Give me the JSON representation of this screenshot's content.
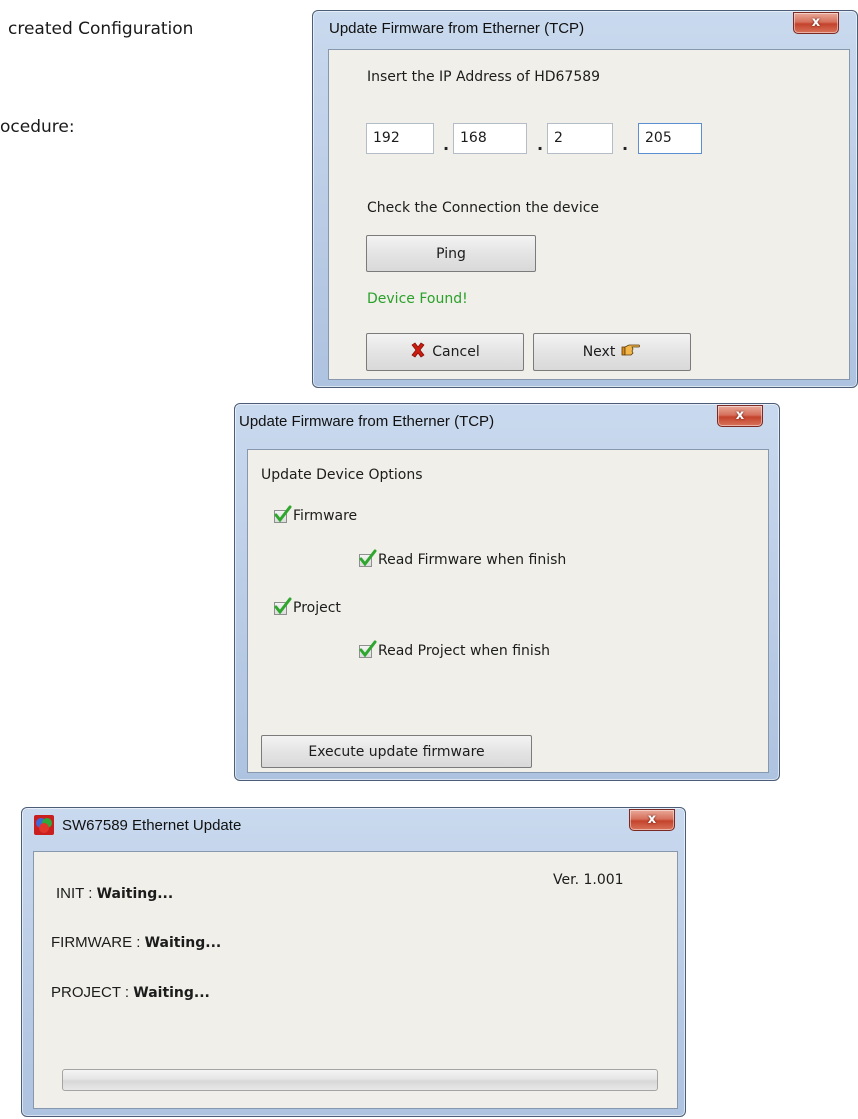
{
  "document": {
    "line1": "created Configuration",
    "line2": "ocedure:"
  },
  "window_ip": {
    "title": "Update Firmware from Etherner (TCP)",
    "close_label": "x",
    "ip_prompt": "Insert the IP Address of HD67589",
    "ip_octets": [
      "192",
      "168",
      "2",
      "205"
    ],
    "ip_separator": ".",
    "check_label": "Check the Connection the device",
    "ping_label": "Ping",
    "status_text": "Device Found!",
    "status_color": "#2aa12a",
    "cancel_label": "Cancel",
    "cancel_icon": "red-x-icon",
    "next_label": "Next",
    "next_icon": "pointing-hand-icon"
  },
  "window_options": {
    "title": "Update Firmware from Etherner (TCP)",
    "close_label": "x",
    "section_label": "Update Device Options",
    "firmware_label": "Firmware",
    "firmware_checked": true,
    "read_firmware_label": "Read Firmware when finish",
    "read_firmware_checked": true,
    "project_label": "Project",
    "project_checked": true,
    "read_project_label": "Read Project when finish",
    "read_project_checked": true,
    "execute_label": "Execute update firmware"
  },
  "window_update": {
    "title": "SW67589 Ethernet Update",
    "close_label": "x",
    "app_icon": "rgb-circles-app-icon",
    "version": "Ver. 1.001",
    "init_label": "INIT : ",
    "init_value": "Waiting...",
    "firmware_label": "FIRMWARE : ",
    "firmware_value": "Waiting...",
    "project_label": "PROJECT : ",
    "project_value": "Waiting...",
    "progress": 0
  }
}
